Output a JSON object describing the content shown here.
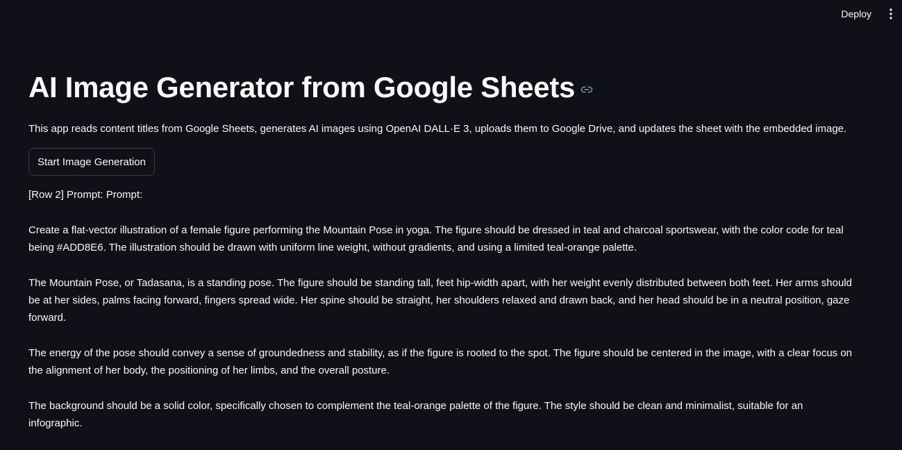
{
  "header": {
    "deploy_label": "Deploy",
    "menu_icon": "vertical-ellipsis-icon"
  },
  "main": {
    "title": "AI Image Generator from Google Sheets",
    "anchor_icon": "link-icon",
    "description": "This app reads content titles from Google Sheets, generates AI images using OpenAI DALL·E 3, uploads them to Google Drive, and updates the sheet with the embedded image.",
    "start_button_label": "Start Image Generation",
    "output_paragraphs": [
      "[Row 2] Prompt: Prompt:",
      "Create a flat-vector illustration of a female figure performing the Mountain Pose in yoga. The figure should be dressed in teal and charcoal sportswear, with the color code for teal being #ADD8E6. The illustration should be drawn with uniform line weight, without gradients, and using a limited teal-orange palette.",
      "The Mountain Pose, or Tadasana, is a standing pose. The figure should be standing tall, feet hip-width apart, with her weight evenly distributed between both feet. Her arms should be at her sides, palms facing forward, fingers spread wide. Her spine should be straight, her shoulders relaxed and drawn back, and her head should be in a neutral position, gaze forward.",
      "The energy of the pose should convey a sense of groundedness and stability, as if the figure is rooted to the spot. The figure should be centered in the image, with a clear focus on the alignment of her body, the positioning of her limbs, and the overall posture.",
      "The background should be a solid color, specifically chosen to complement the teal-orange palette of the figure. The style should be clean and minimalist, suitable for an infographic."
    ]
  },
  "colors": {
    "background": "#0e1117",
    "text": "#fafafa",
    "button_border": "#3b3d45"
  }
}
